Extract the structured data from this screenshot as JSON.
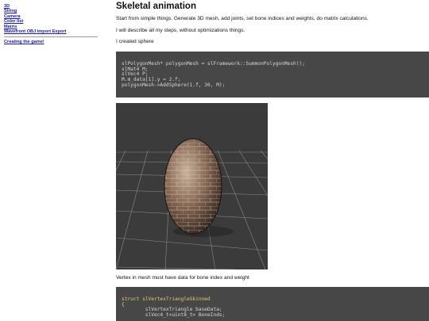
{
  "sidebar": {
    "links": [
      "3D",
      "String",
      "Camera",
      "Color list",
      "Matrix",
      "Wavefront OBJ Import Export"
    ],
    "extra_link": "Creating the game!"
  },
  "page": {
    "title": "Skeletal animation",
    "intro": "Start from simple things. Generate 3D mesh, add joints, set bone indices and weights, do matrix calculations.",
    "describe": "I will describe all my steps, without optimizations things.",
    "created": "I created sphere",
    "vertex_note": "Vertex in mesh must have data for bone index and weight"
  },
  "code1": {
    "lines": [
      "slPolygonMesh* polygonMesh = slFramework::SummonPolygonMesh();",
      "slMat4 M;",
      "slVec4 P;",
      "M.m_data[1].y = 2.f;",
      "polygonMesh->AddSphere(1.f, 30, M);"
    ]
  },
  "code2": {
    "lines": [
      "struct slVertexTriangleSkinned",
      "{",
      "        slVertexTriangle baseData;",
      "        slVec4_t<uint8_t> BoneInds;"
    ]
  },
  "colors": {
    "code_bg": "#474747",
    "link": "#1a1aa6",
    "render_bg": "#3a3a3a"
  }
}
